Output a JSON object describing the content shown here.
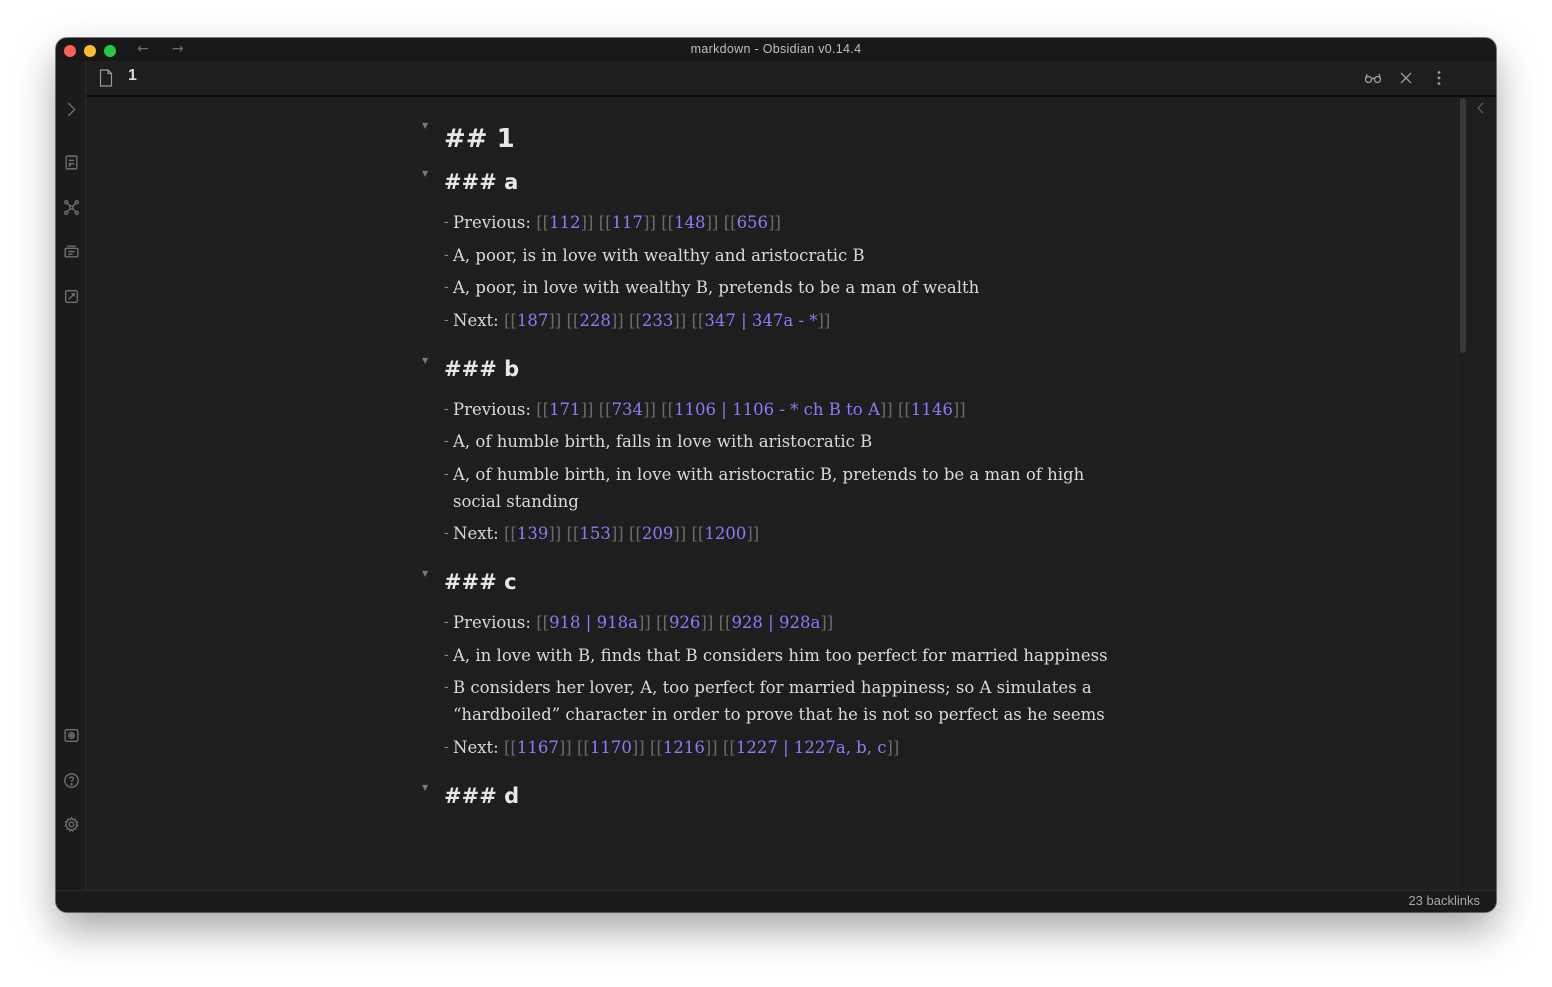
{
  "window": {
    "title": "markdown - Obsidian v0.14.4",
    "back_arrow": "←",
    "forward_arrow": "→"
  },
  "pane": {
    "title": "1",
    "actions": [
      "reading-mode-icon",
      "close-icon",
      "more-options-icon"
    ]
  },
  "ribbon": {
    "top_icons": [
      "expand-sidebar-icon",
      "command-palette-icon",
      "graph-view-icon",
      "templates-icon",
      "random-note-icon"
    ],
    "bottom_icons": [
      "vault-icon",
      "help-icon",
      "settings-icon"
    ]
  },
  "document": {
    "h2": "## 1",
    "sections": [
      {
        "heading": "### a",
        "items": [
          {
            "prefix": "Previous: ",
            "links": [
              "112",
              "117",
              "148",
              "656"
            ]
          },
          {
            "text": "A, poor, is in love with wealthy and aristocratic B"
          },
          {
            "text": "A, poor, in love with wealthy B, pretends to be a man of wealth"
          },
          {
            "prefix": "Next: ",
            "links": [
              "187",
              "228",
              "233",
              "347 | 347a - *"
            ]
          }
        ]
      },
      {
        "heading": "### b",
        "items": [
          {
            "prefix": "Previous: ",
            "links": [
              "171",
              "734",
              "1106 | 1106 - * ch B to A",
              "1146"
            ]
          },
          {
            "text": "A, of humble birth, falls in love with aristocratic B"
          },
          {
            "text": "A, of humble birth, in love with aristocratic B, pretends to be a man of high social standing"
          },
          {
            "prefix": "Next: ",
            "links": [
              "139",
              "153",
              "209",
              "1200"
            ]
          }
        ]
      },
      {
        "heading": "### c",
        "items": [
          {
            "prefix": "Previous: ",
            "links": [
              "918 | 918a",
              "926",
              "928 | 928a"
            ]
          },
          {
            "text": "A, in love with B, finds that B considers him too perfect for married happiness"
          },
          {
            "text": "B considers her lover, A, too perfect for married happiness; so A simulates a “hardboiled” character in order to prove that he is not so perfect as he seems"
          },
          {
            "prefix": "Next: ",
            "links": [
              "1167",
              "1170",
              "1216",
              "1227 | 1227a, b, c"
            ]
          }
        ]
      },
      {
        "heading": "### d",
        "items": []
      }
    ]
  },
  "status": {
    "backlinks": "23 backlinks"
  },
  "colors": {
    "link": "#8b7cf6",
    "background": "#1e1e1e",
    "text": "#dcdcdc"
  }
}
